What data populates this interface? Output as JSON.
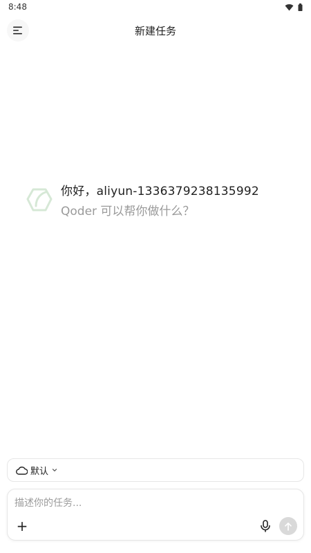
{
  "status_bar": {
    "time": "8:48",
    "icons": [
      "wifi-icon",
      "battery-icon"
    ]
  },
  "header": {
    "title": "新建任务",
    "menu_icon": "menu-icon"
  },
  "greeting": {
    "line1": "你好，aliyun-1336379238135992",
    "line2": "Qoder 可以帮你做什么？"
  },
  "model_selector": {
    "label": "默认",
    "icon": "cloud-icon",
    "chevron": "chevron-down-icon"
  },
  "composer": {
    "placeholder": "描述你的任务...",
    "value": "",
    "add_icon_glyph": "+",
    "mic_icon": "microphone-icon",
    "send_icon": "arrow-up-icon"
  },
  "colors": {
    "accent_logo": "#cfe3cf",
    "send_disabled": "#d9d9d9",
    "muted_text": "#9a9a9a"
  }
}
